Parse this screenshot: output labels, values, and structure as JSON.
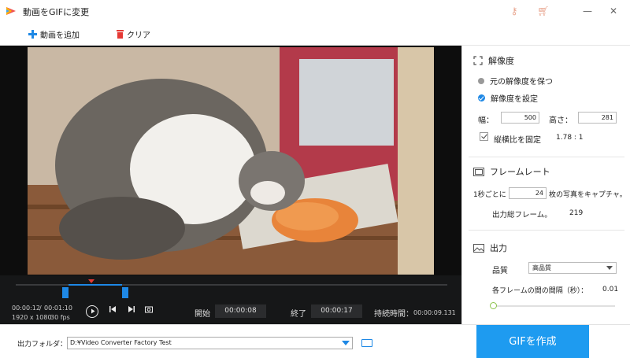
{
  "window": {
    "title": "動画をGIFに変更",
    "minimize": "—",
    "close": "✕"
  },
  "toolbar": {
    "add_label": "動画を追加",
    "clear_label": "クリア"
  },
  "player": {
    "current_time": "00:00:12",
    "separator": "/",
    "total_time": "00:01:10",
    "resolution": "1920 x 1080",
    "fps": "30 fps",
    "start_label": "開始",
    "start_time": "00:00:08",
    "end_label": "終了",
    "end_time": "00:00:17",
    "duration_label": "持続時間：",
    "duration_value": "00:00:09.131",
    "range_start": 0.123,
    "range_end": 0.246,
    "playhead": 0.175
  },
  "resolution": {
    "title": "解像度",
    "keep_label": "元の解像度を保つ",
    "set_label": "解像度を設定",
    "selected": "set",
    "width_label": "幅：",
    "width_value": "500",
    "height_label": "高さ：",
    "height_value": "281",
    "lock_label": "縦横比を固定",
    "lock_checked": true,
    "ratio": "1.78 : 1"
  },
  "framerate": {
    "title": "フレームレート",
    "prefix": "1秒ごとに",
    "value": "24",
    "suffix": "枚の写真をキャプチャ。",
    "total_label": "出力総フレーム。",
    "total_value": "219"
  },
  "output": {
    "title": "出力",
    "quality_label": "品質",
    "quality_value": "高品質",
    "interval_label": "各フレームの間の間隔（秒）：",
    "interval_value": "0.01",
    "interval_slider": 0.0
  },
  "bottom": {
    "folder_label": "出力フォルダ：",
    "folder_path": "D:¥Video Converter Factory Test",
    "create_label": "GIFを作成"
  },
  "colors": {
    "accent": "#1e88e5",
    "create_button": "#1e9bf0",
    "clear_icon": "#e53935",
    "player_bg": "#161718"
  }
}
